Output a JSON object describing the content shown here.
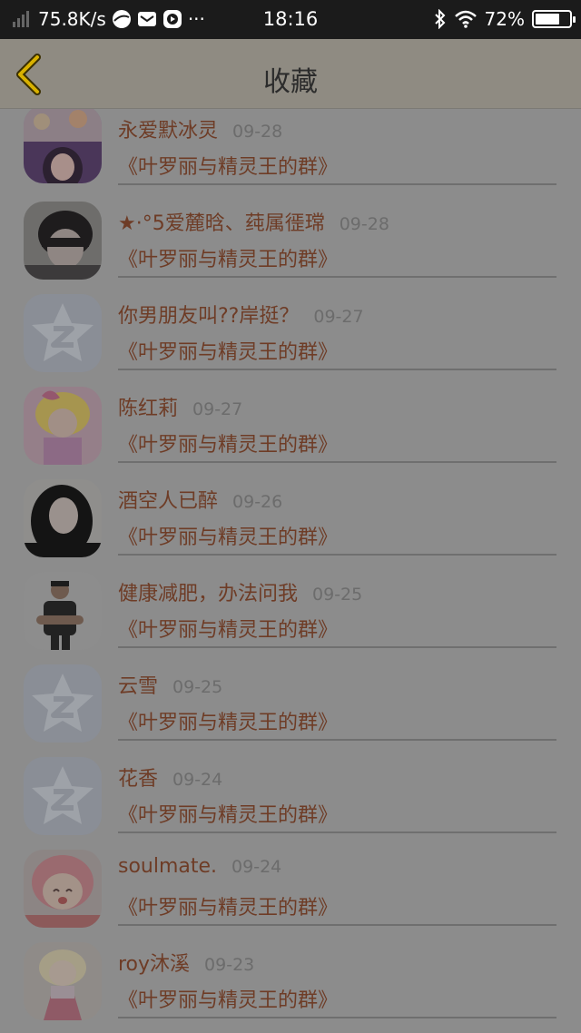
{
  "status_bar": {
    "net_speed": "75.8K/s",
    "more": "···",
    "time": "18:16",
    "battery": "72%",
    "battery_level": 0.72,
    "icons": [
      "signal-bars-icon",
      "browser-icon",
      "mail-icon",
      "media-icon",
      "bluetooth-icon",
      "wifi-icon",
      "battery-icon"
    ]
  },
  "header": {
    "title": "收藏",
    "back_icon": "chevron-left-icon",
    "accent": "#d8b100"
  },
  "items": [
    {
      "name": "永爱默冰灵",
      "date": "09-28",
      "group": "《叶罗丽与精灵王的群》",
      "avatar": "doll-photo"
    },
    {
      "name": "★·°5爱麓晗、莼属徰瑺",
      "date": "09-28",
      "group": "《叶罗丽与精灵王的群》",
      "avatar": "boy-photo"
    },
    {
      "name": "你男朋友叫??岸挺？",
      "date": "09-27",
      "group": "《叶罗丽与精灵王的群》",
      "avatar": "qzone-star-icon"
    },
    {
      "name": "陈红莉",
      "date": "09-27",
      "group": "《叶罗丽与精灵王的群》",
      "avatar": "anime-girl-photo"
    },
    {
      "name": "酒空人已醉",
      "date": "09-26",
      "group": "《叶罗丽与精灵王的群》",
      "avatar": "woman-photo"
    },
    {
      "name": "健康减肥，办法问我",
      "date": "09-25",
      "group": "《叶罗丽与精灵王的群》",
      "avatar": "man-photo"
    },
    {
      "name": "云雪",
      "date": "09-25",
      "group": "《叶罗丽与精灵王的群》",
      "avatar": "qzone-star-icon"
    },
    {
      "name": "花香",
      "date": "09-24",
      "group": "《叶罗丽与精灵王的群》",
      "avatar": "qzone-star-icon"
    },
    {
      "name": "soulmate.",
      "date": "09-24",
      "group": "《叶罗丽与精灵王的群》",
      "avatar": "anime-pink-hair-photo"
    },
    {
      "name": "roy沐溪",
      "date": "09-23",
      "group": "《叶罗丽与精灵王的群》",
      "avatar": "anime-doll-photo"
    }
  ]
}
